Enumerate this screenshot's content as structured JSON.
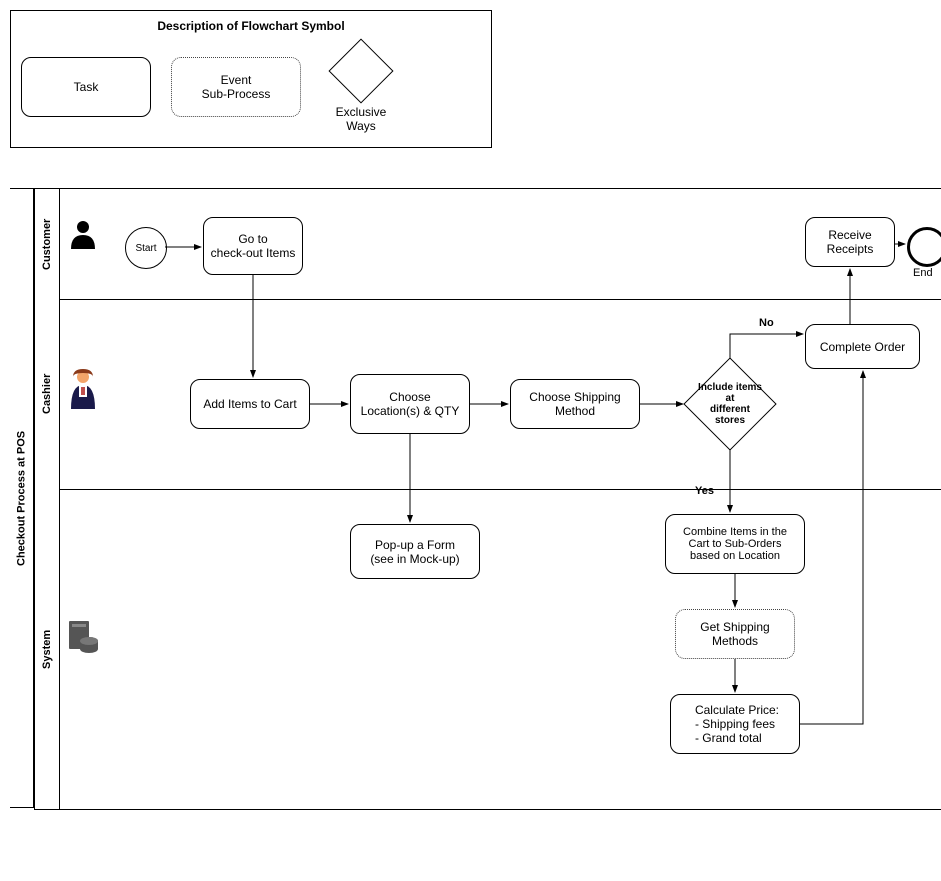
{
  "legend": {
    "title": "Description of Flowchart Symbol",
    "task_label": "Task",
    "subprocess_label": "Event\nSub-Process",
    "exclusive_label": "Exclusive\nWays"
  },
  "pool_title": "Checkout Process at POS",
  "lanes": {
    "customer": "Customer",
    "cashier": "Cashier",
    "system": "System"
  },
  "nodes": {
    "start": "Start",
    "goto_checkout": "Go to\ncheck-out Items",
    "add_items": "Add Items to Cart",
    "choose_location": "Choose\nLocation(s) & QTY",
    "choose_shipping": "Choose Shipping\nMethod",
    "decision": "Include items\nat\ndifferent\nstores",
    "complete_order": "Complete Order",
    "receive_receipts": "Receive\nReceipts",
    "end": "End",
    "popup_form": "Pop-up a Form\n(see in Mock-up)",
    "combine_items": "Combine Items in the\nCart to Sub-Orders\nbased on Location",
    "get_shipping": "Get Shipping\nMethods",
    "calc_price": "Calculate Price:\n- Shipping fees\n- Grand total"
  },
  "edges": {
    "no": "No",
    "yes": "Yes"
  }
}
